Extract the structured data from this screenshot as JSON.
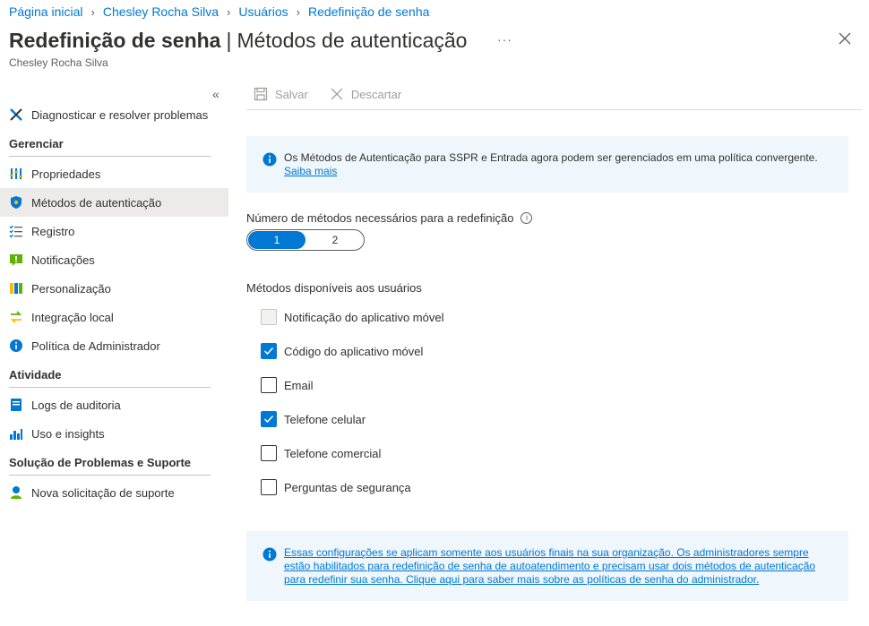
{
  "breadcrumb": [
    "Página inicial",
    "Chesley Rocha Silva",
    "Usuários",
    "Redefinição de senha"
  ],
  "header": {
    "title": "Redefinição de senha",
    "divider": "|",
    "subtitle_title": "Métodos de autenticação",
    "more": "···",
    "subtitle": "Chesley Rocha Silva"
  },
  "sidebar": {
    "collapse": "«",
    "top_item": "Diagnosticar e resolver problemas",
    "sections": [
      {
        "title": "Gerenciar",
        "items": [
          "Propriedades",
          "Métodos de autenticação",
          "Registro",
          "Notificações",
          "Personalização",
          "Integração local",
          "Política de Administrador"
        ]
      },
      {
        "title": "Atividade",
        "items": [
          "Logs de auditoria",
          "Uso e insights"
        ]
      },
      {
        "title": "Solução de Problemas e Suporte",
        "items": [
          "Nova solicitação de suporte"
        ]
      }
    ],
    "active": "Métodos de autenticação"
  },
  "toolbar": {
    "save": "Salvar",
    "discard": "Descartar"
  },
  "banner_top": {
    "text": "Os Métodos de Autenticação para SSPR e Entrada agora podem ser gerenciados em uma política convergente.",
    "link": "Saiba mais"
  },
  "methods_required": {
    "label": "Número de métodos necessários para a redefinição",
    "options": [
      "1",
      "2"
    ],
    "selected": "1"
  },
  "methods": {
    "label": "Métodos disponíveis aos usuários",
    "items": [
      {
        "label": "Notificação do aplicativo móvel",
        "state": "disabled"
      },
      {
        "label": "Código do aplicativo móvel",
        "state": "checked"
      },
      {
        "label": "Email",
        "state": "unchecked"
      },
      {
        "label": "Telefone celular",
        "state": "checked"
      },
      {
        "label": "Telefone comercial",
        "state": "unchecked"
      },
      {
        "label": "Perguntas de segurança",
        "state": "unchecked"
      }
    ]
  },
  "banner_bottom": {
    "text": "Essas configurações se aplicam somente aos usuários finais na sua organização. Os administradores sempre estão habilitados para redefinição de senha de autoatendimento e precisam usar dois métodos de autenticação para redefinir sua senha. Clique aqui para saber mais sobre as políticas de senha do administrador."
  },
  "colors": {
    "accent": "#0078d4",
    "info_bg": "#eff6fc"
  }
}
